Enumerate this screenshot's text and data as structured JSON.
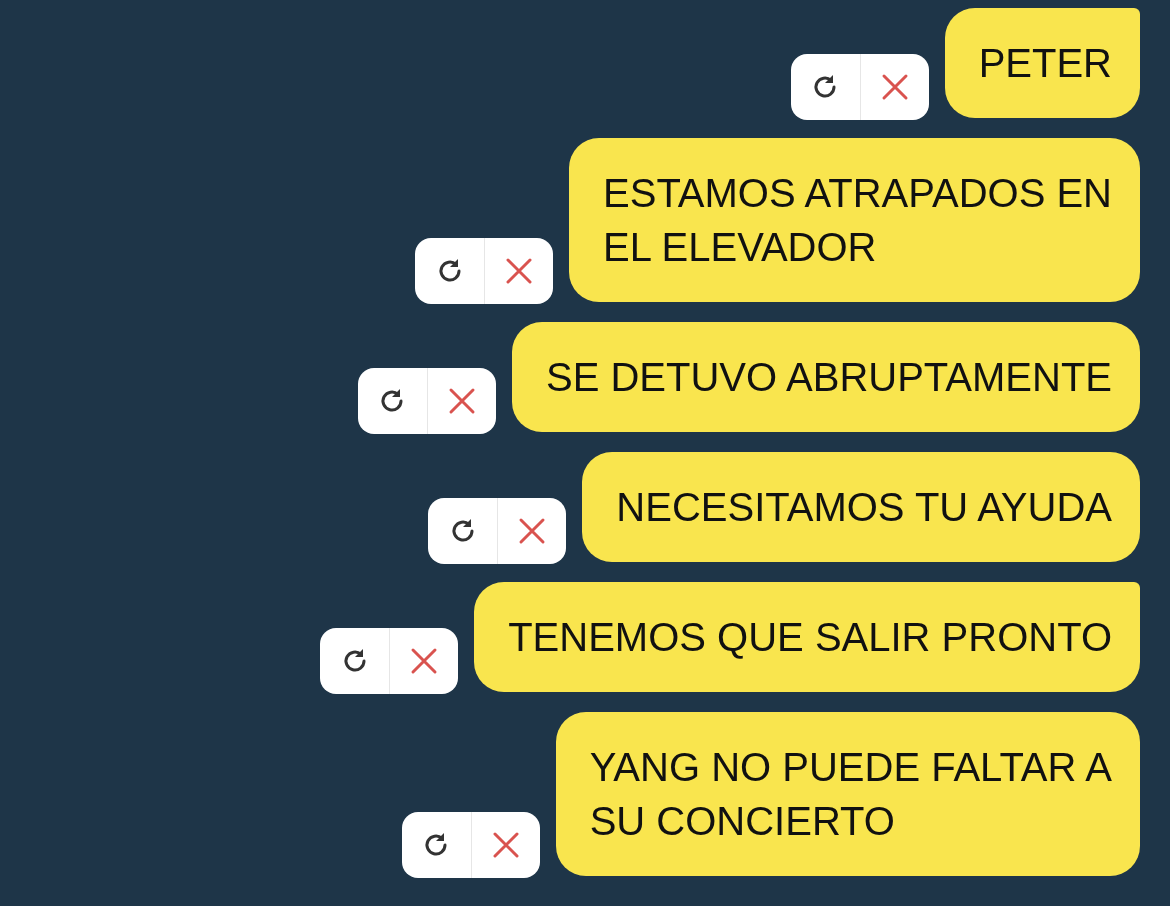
{
  "messages": [
    {
      "text": "PETER",
      "tail": true
    },
    {
      "text": "ESTAMOS ATRAPADOS EN\nEL ELEVADOR",
      "tail": false
    },
    {
      "text": "SE DETUVO ABRUPTAMENTE",
      "tail": false
    },
    {
      "text": "NECESITAMOS TU AYUDA",
      "tail": false
    },
    {
      "text": "TENEMOS QUE SALIR PRONTO",
      "tail": true
    },
    {
      "text": "YANG NO PUEDE FALTAR A\nSU CONCIERTO",
      "tail": false
    }
  ]
}
